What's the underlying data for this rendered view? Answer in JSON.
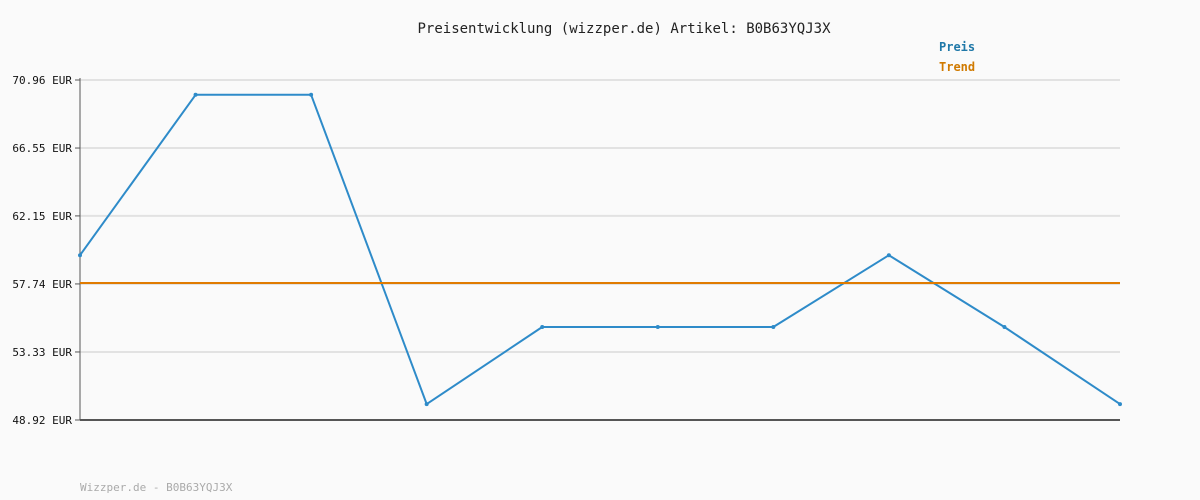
{
  "chart_data": {
    "type": "line",
    "title": "Preisentwicklung (wizzper.de) Artikel: B0B63YQJ3X",
    "xlabel": "",
    "ylabel": "",
    "ylim": [
      48.92,
      70.96
    ],
    "y_ticks": [
      "70.96 EUR",
      "66.55 EUR",
      "62.15 EUR",
      "57.74 EUR",
      "53.33 EUR",
      "48.92 EUR"
    ],
    "y_tick_values": [
      70.96,
      66.55,
      62.15,
      57.74,
      53.33,
      48.92
    ],
    "x": [
      0,
      1,
      2,
      3,
      4,
      5,
      6,
      7,
      8,
      9
    ],
    "series": [
      {
        "name": "Preis",
        "color": "#2e8bc9",
        "values": [
          59.6,
          70.0,
          70.0,
          49.95,
          54.95,
          54.95,
          54.95,
          59.6,
          54.95,
          49.95
        ]
      },
      {
        "name": "Trend",
        "color": "#e07b00",
        "values": [
          57.8,
          57.8,
          57.8,
          57.8,
          57.8,
          57.8,
          57.8,
          57.8,
          57.8,
          57.8
        ]
      }
    ],
    "grid": true,
    "legend_position": "top-right",
    "legend_preis_color": "#1f78a8",
    "legend_trend_color": "#d07a00"
  },
  "footer": {
    "text": "Wizzper.de - B0B63YQJ3X"
  }
}
